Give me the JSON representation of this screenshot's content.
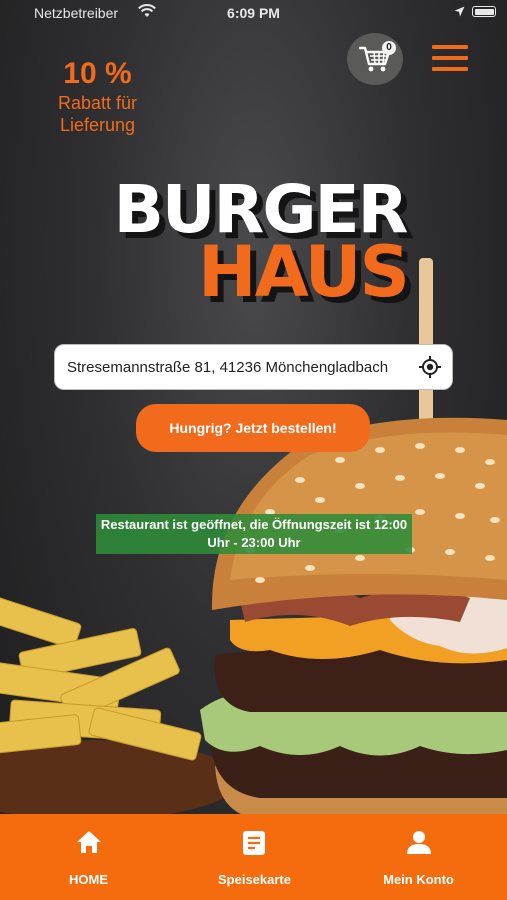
{
  "status_bar": {
    "carrier": "Netzbetreiber",
    "time": "6:09 PM"
  },
  "promo": {
    "percent": "10 %",
    "line1": "Rabatt für",
    "line2": "Lieferung"
  },
  "cart": {
    "count": "0"
  },
  "logo": {
    "line1": "BURGER",
    "line2": "HAUS"
  },
  "address": {
    "value": "Stresemannstraße 81, 41236 Mönchengladbach"
  },
  "order_button": {
    "label": "Hungrig? Jetzt bestellen!"
  },
  "open_status": {
    "line1": "Restaurant ist geöffnet, die Öffnungszeit ist 12:00",
    "line2": "Uhr - 23:00 Uhr"
  },
  "tabs": [
    {
      "label": "HOME",
      "icon": "home-icon"
    },
    {
      "label": "Speisekarte",
      "icon": "menu-card-icon"
    },
    {
      "label": "Mein Konto",
      "icon": "user-icon"
    }
  ],
  "colors": {
    "accent": "#f26b1d",
    "tabbar": "#f56c0f",
    "open_banner": "#2e8c38",
    "background": "#2f2f31"
  }
}
